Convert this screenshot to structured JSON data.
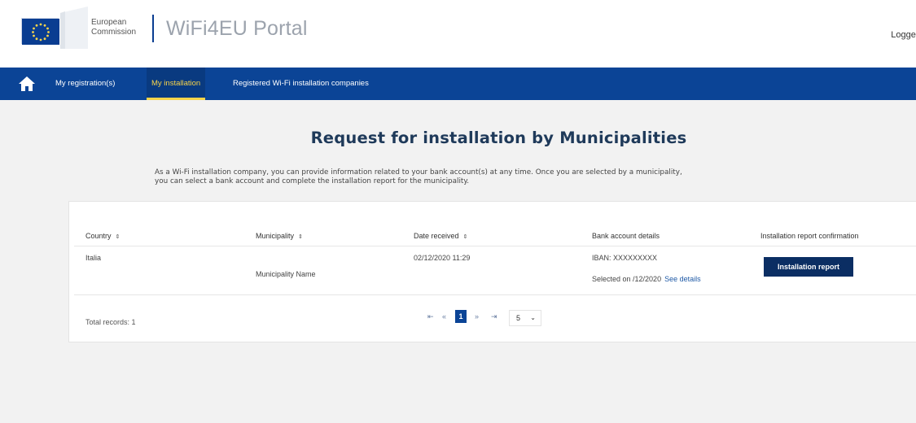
{
  "header": {
    "logo_line1": "European",
    "logo_line2": "Commission",
    "portal_title": "WiFi4EU Portal",
    "logged_text": "Logged"
  },
  "nav": {
    "items": [
      {
        "label": "My registration(s)",
        "active": false
      },
      {
        "label": "My installation",
        "active": true
      },
      {
        "label": "Registered Wi-Fi installation companies",
        "active": false
      }
    ],
    "bar_color": "#0b4496",
    "active_color": "#f7d44a"
  },
  "main": {
    "title": "Request for installation by Municipalities",
    "intro_line1": "As a Wi-Fi installation company, you can provide information related to your bank account(s) at any time. Once you are selected by a municipality,",
    "intro_line2": "you can select a bank account and complete the installation report for the municipality."
  },
  "table": {
    "columns": [
      {
        "label": "Country",
        "sort": "⇕"
      },
      {
        "label": "Municipality",
        "sort": "⇕"
      },
      {
        "label": "Date received",
        "sort": "⇕"
      },
      {
        "label": "Bank account details",
        "sort": ""
      },
      {
        "label": "Installation report confirmation",
        "sort": ""
      }
    ],
    "rows": [
      {
        "country": "Italia",
        "municipality": "Municipality Name",
        "date_received": "02/12/2020 11:29",
        "iban": "IBAN: XXXXXXXXX",
        "selected_on": "Selected on    /12/2020",
        "see_details": "See details",
        "action": "Installation report"
      }
    ],
    "total_records": "Total records: 1",
    "pagination": {
      "first": "⇤",
      "prev": "«",
      "current": "1",
      "next": "»",
      "last": "⇥",
      "page_size": "5"
    }
  }
}
